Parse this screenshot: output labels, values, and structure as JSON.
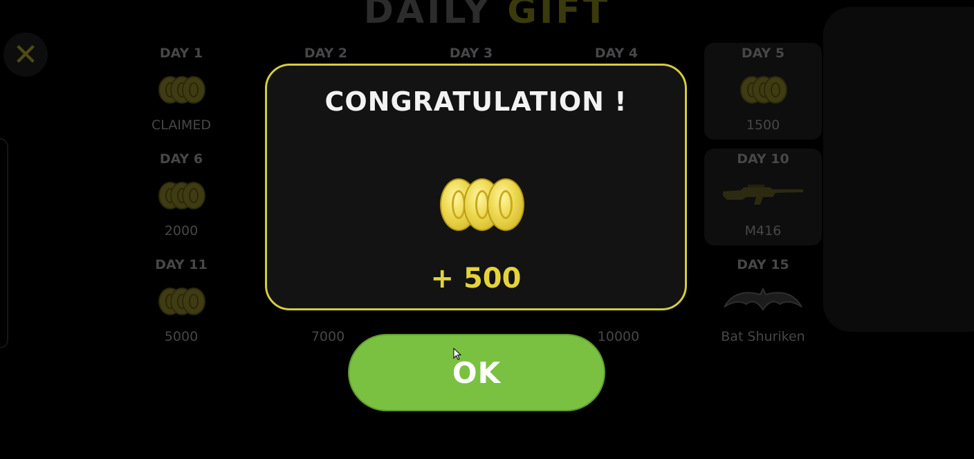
{
  "background": {
    "title_part1": "DAILY",
    "title_part2": "GIFT",
    "close_glyph": "✕",
    "days": [
      {
        "label": "DAY 1",
        "value": "CLAIMED",
        "reward": "coins"
      },
      {
        "label": "DAY 2",
        "value": "",
        "reward": ""
      },
      {
        "label": "DAY 3",
        "value": "",
        "reward": ""
      },
      {
        "label": "DAY 4",
        "value": "",
        "reward": ""
      },
      {
        "label": "DAY 5",
        "value": "1500",
        "reward": "coins"
      },
      {
        "label": "DAY 6",
        "value": "2000",
        "reward": "coins"
      },
      {
        "label": "DAY 10",
        "value": "M416",
        "reward": "rifle"
      },
      {
        "label": "DAY 11",
        "value": "5000",
        "reward": "coins"
      },
      {
        "label": "",
        "value": "7000",
        "reward": ""
      },
      {
        "label": "",
        "value": "10000",
        "reward": ""
      },
      {
        "label": "DAY 15",
        "value": "Bat Shuriken",
        "reward": "bat-shuriken"
      }
    ]
  },
  "dialog": {
    "title": "CONGRATULATION !",
    "icon": "gold-coins-icon",
    "reward_amount": "+ 500"
  },
  "ok_button": {
    "label": "OK"
  },
  "colors": {
    "dialog_border": "#d4cd3e",
    "reward_text": "#e4d33b",
    "ok_green": "#7ac142"
  }
}
